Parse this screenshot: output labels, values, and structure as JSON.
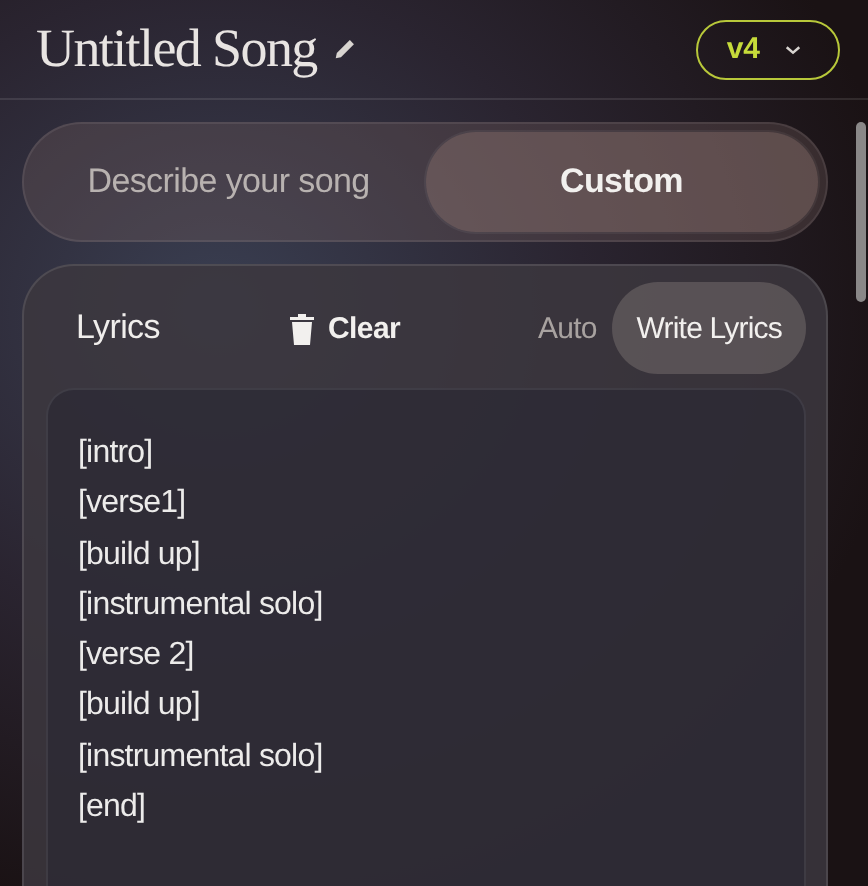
{
  "title": "Untitled Song",
  "version": {
    "label": "v4"
  },
  "mode_tabs": [
    {
      "label": "Describe your song",
      "selected": false
    },
    {
      "label": "Custom",
      "selected": true
    }
  ],
  "lyrics_panel": {
    "title": "Lyrics",
    "clear_label": "Clear",
    "modes": [
      {
        "label": "Auto",
        "selected": false
      },
      {
        "label": "Write Lyrics",
        "selected": true
      }
    ],
    "lines": [
      "[intro]",
      "[verse1]",
      "[build up]",
      "[instrumental solo]",
      "[verse 2]",
      "[build up]",
      "[instrumental solo]",
      "[end]"
    ]
  }
}
